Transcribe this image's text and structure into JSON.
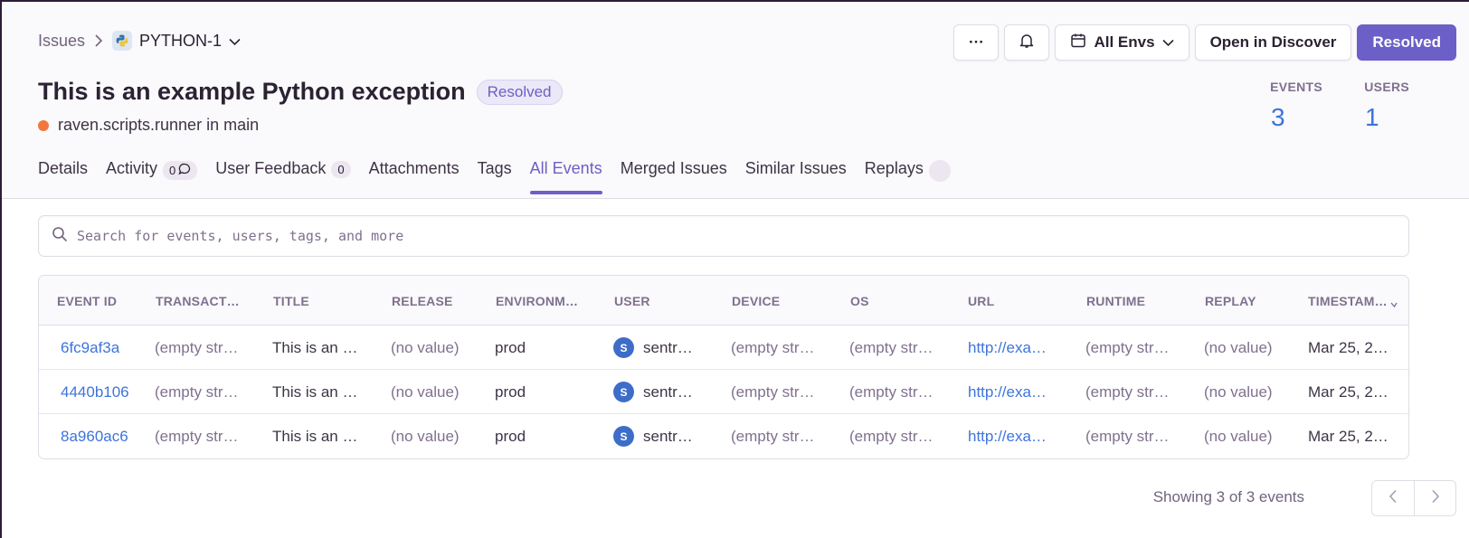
{
  "breadcrumb": {
    "issues": "Issues",
    "project": "PYTHON-1"
  },
  "actions": {
    "more": "···",
    "environment": "All Envs",
    "discover": "Open in Discover",
    "resolved": "Resolved"
  },
  "issue": {
    "title": "This is an example Python exception",
    "status": "Resolved",
    "culprit": "raven.scripts.runner in main"
  },
  "stats": {
    "events_label": "EVENTS",
    "events_value": "3",
    "users_label": "USERS",
    "users_value": "1"
  },
  "tabs": [
    {
      "label": "Details"
    },
    {
      "label": "Activity",
      "badge": "0"
    },
    {
      "label": "User Feedback",
      "badge": "0"
    },
    {
      "label": "Attachments"
    },
    {
      "label": "Tags"
    },
    {
      "label": "All Events",
      "active": true
    },
    {
      "label": "Merged Issues"
    },
    {
      "label": "Similar Issues"
    },
    {
      "label": "Replays"
    }
  ],
  "search": {
    "placeholder": "Search for events, users, tags, and more"
  },
  "table": {
    "columns": [
      "EVENT ID",
      "TRANSACT…",
      "TITLE",
      "RELEASE",
      "ENVIRONM…",
      "USER",
      "DEVICE",
      "OS",
      "URL",
      "RUNTIME",
      "REPLAY",
      "TIMESTAM…"
    ],
    "rows": [
      {
        "event_id": "6fc9af3a",
        "transaction": "(empty str…",
        "title": "This is an …",
        "release": "(no value)",
        "environment": "prod",
        "user_initial": "S",
        "user": "sentr…",
        "device": "(empty str…",
        "os": "(empty str…",
        "url": "http://exa…",
        "runtime": "(empty str…",
        "replay": "(no value)",
        "timestamp": "Mar 25, 2…"
      },
      {
        "event_id": "4440b106",
        "transaction": "(empty str…",
        "title": "This is an …",
        "release": "(no value)",
        "environment": "prod",
        "user_initial": "S",
        "user": "sentr…",
        "device": "(empty str…",
        "os": "(empty str…",
        "url": "http://exa…",
        "runtime": "(empty str…",
        "replay": "(no value)",
        "timestamp": "Mar 25, 2…"
      },
      {
        "event_id": "8a960ac6",
        "transaction": "(empty str…",
        "title": "This is an …",
        "release": "(no value)",
        "environment": "prod",
        "user_initial": "S",
        "user": "sentr…",
        "device": "(empty str…",
        "os": "(empty str…",
        "url": "http://exa…",
        "runtime": "(empty str…",
        "replay": "(no value)",
        "timestamp": "Mar 25, 2…"
      }
    ]
  },
  "pagination": {
    "summary": "Showing 3 of 3 events"
  },
  "colors": {
    "accent": "#6c5fc7",
    "link": "#3d74db",
    "level_error": "#f2773c",
    "avatar": "#3e6dc9"
  },
  "icons": [
    "python-icon",
    "chevron-right-icon",
    "chevron-down-icon",
    "bell-icon",
    "calendar-icon",
    "comment-icon",
    "search-icon",
    "sort-icon",
    "chevron-left-icon"
  ]
}
